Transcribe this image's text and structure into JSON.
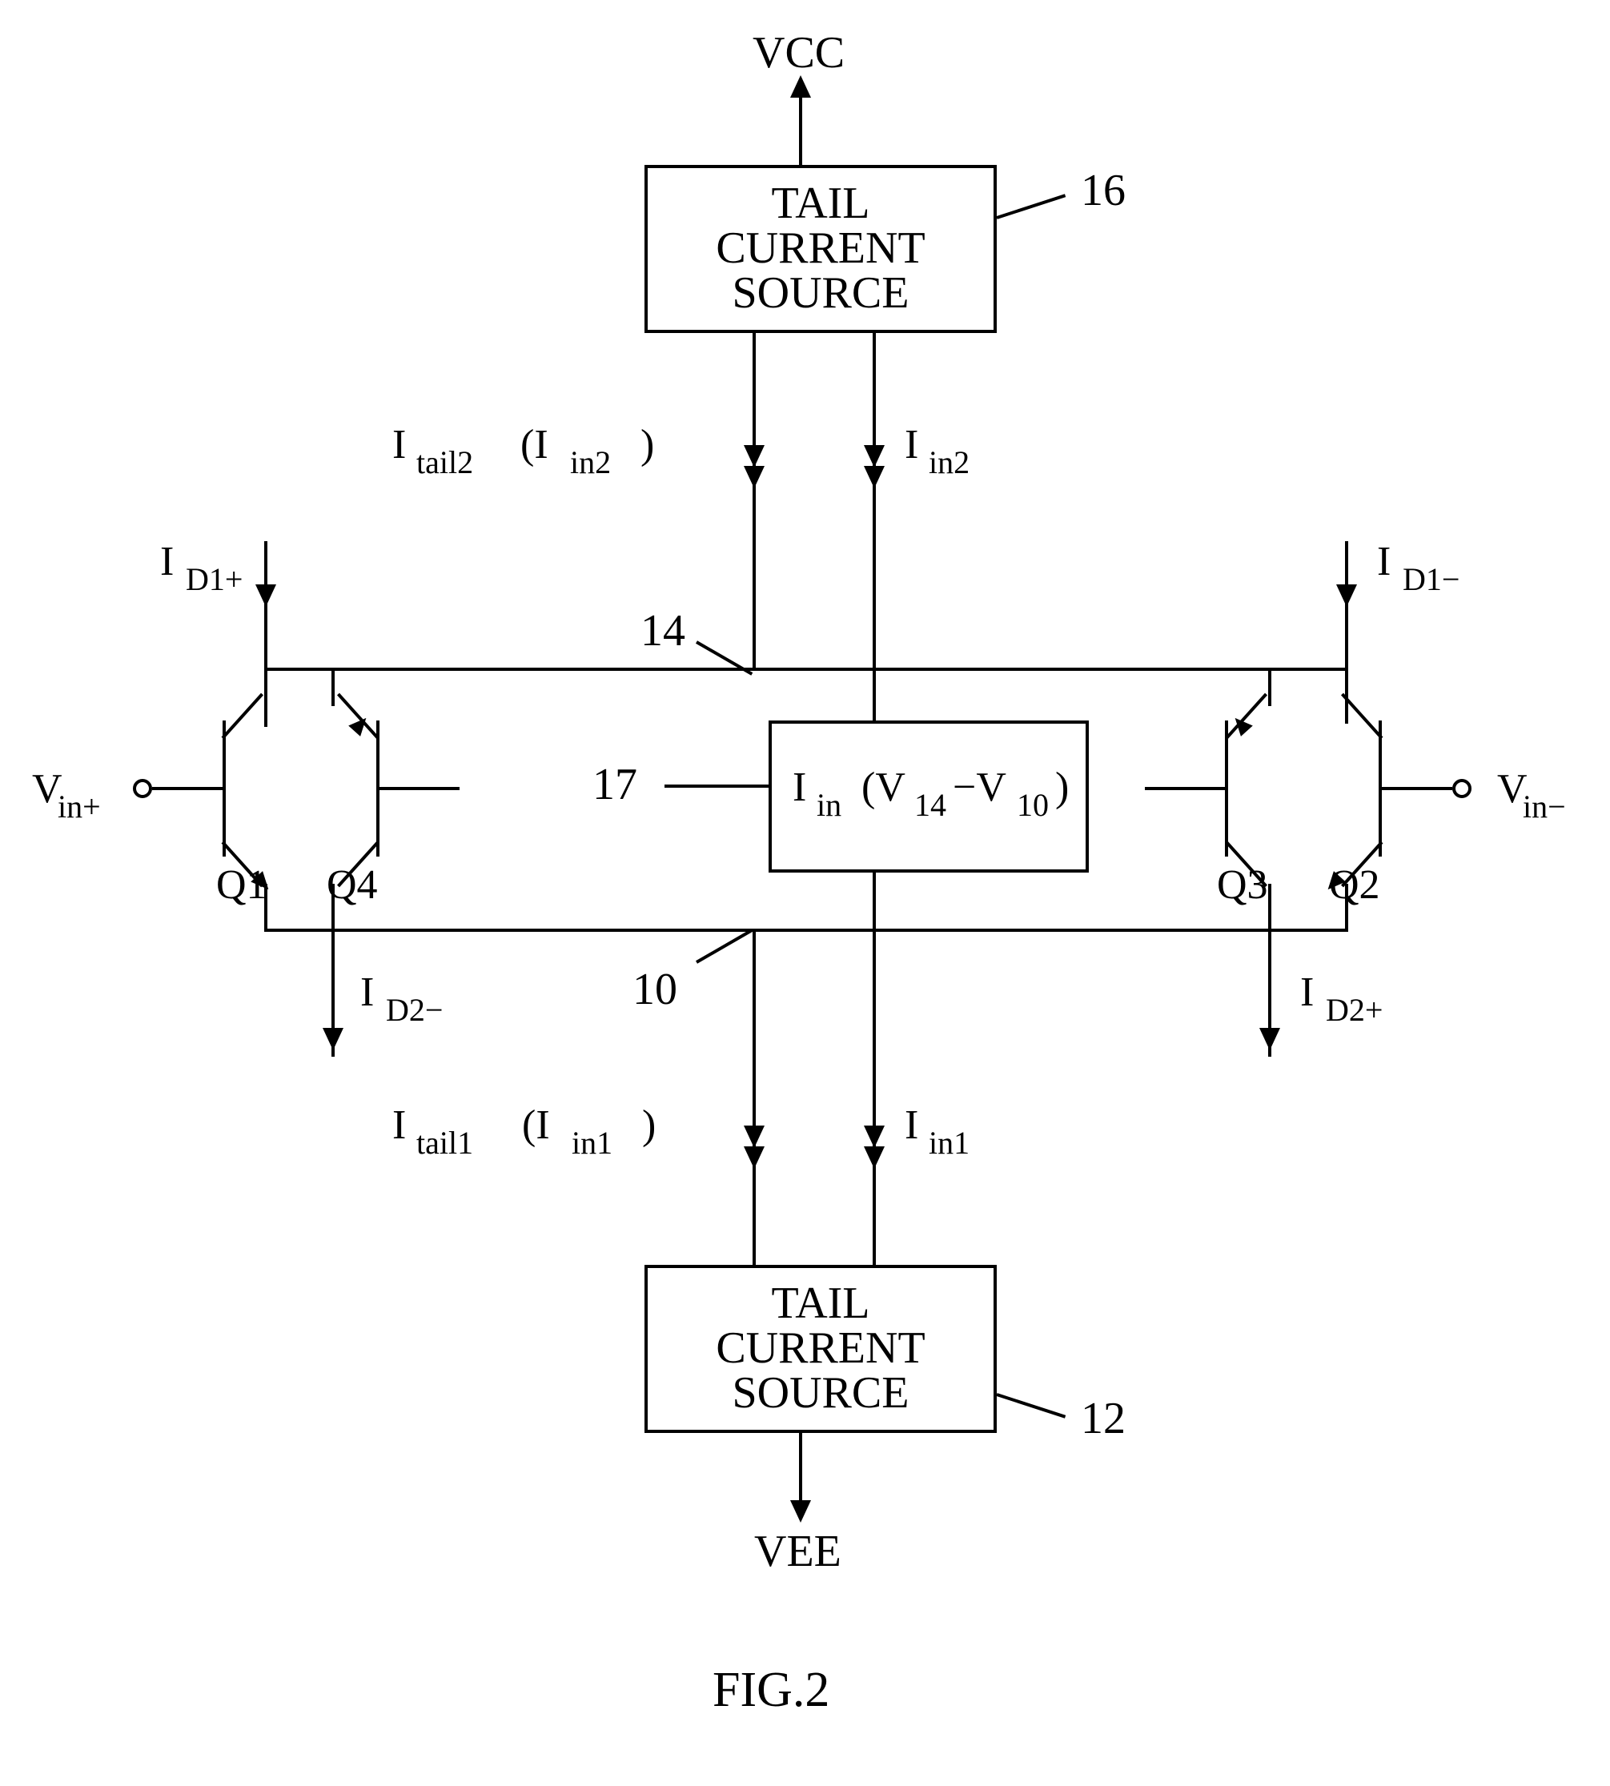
{
  "rails": {
    "vcc": "VCC",
    "vee": "VEE"
  },
  "blocks": {
    "tail_top": "TAIL\nCURRENT\nSOURCE",
    "tail_bot": "TAIL\nCURRENT\nSOURCE",
    "comp": "I"
  },
  "comp_sub": "in",
  "comp_arg_a": "(V",
  "comp_arg_a_sub": "14",
  "comp_arg_mid": "−V",
  "comp_arg_b_sub": "10",
  "comp_arg_close": ")",
  "refnums": {
    "top_src": "16",
    "bot_src": "12",
    "node_top": "14",
    "node_bot": "10",
    "comp": "17"
  },
  "trans": {
    "q1": "Q1",
    "q2": "Q2",
    "q3": "Q3",
    "q4": "Q4"
  },
  "vin": {
    "plus_a": "V",
    "plus_sub": "in+",
    "minus_a": "V",
    "minus_sub": "in−"
  },
  "currents": {
    "id1p_a": "I",
    "id1p_sub": "D1+",
    "id1m_a": "I",
    "id1m_sub": "D1−",
    "id2p_a": "I",
    "id2p_sub": "D2+",
    "id2m_a": "I",
    "id2m_sub": "D2−",
    "itail2_a": "I",
    "itail2_sub": "tail2",
    "iin2p_a": "(I",
    "iin2p_sub": "in2",
    "iin2p_close": ")",
    "iin2_a": "I",
    "iin2_sub": "in2",
    "itail1_a": "I",
    "itail1_sub": "tail1",
    "iin1p_a": "(I",
    "iin1p_sub": "in1",
    "iin1p_close": ")",
    "iin1_a": "I",
    "iin1_sub": "in1"
  },
  "figure": "FIG.2"
}
